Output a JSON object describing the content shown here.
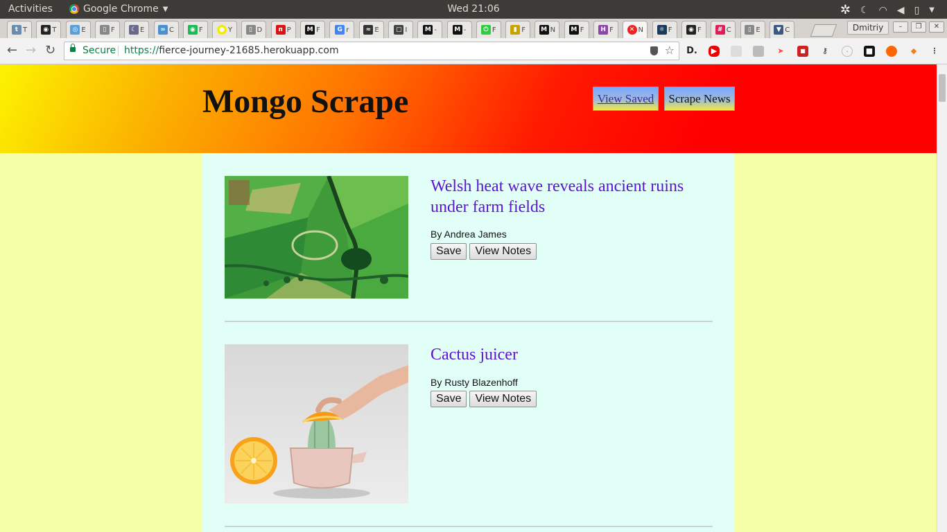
{
  "os": {
    "activities": "Activities",
    "app_name": "Google Chrome",
    "clock": "Wed 21:06"
  },
  "browser": {
    "profile": "Dmitriy",
    "secure_label": "Secure",
    "url_scheme": "https://",
    "url_host": "fierce-journey-21685.herokuapp.com"
  },
  "tabs": [
    {
      "icon": "T",
      "color": "#6a8caf",
      "label": "T"
    },
    {
      "icon": "github",
      "color": "#222",
      "label": "T"
    },
    {
      "icon": "eye",
      "color": "#5aa0d8",
      "label": "E"
    },
    {
      "icon": "doc",
      "color": "#888",
      "label": "F"
    },
    {
      "icon": "moon",
      "color": "#6a6a8a",
      "label": "E"
    },
    {
      "icon": "link",
      "color": "#4a8fd0",
      "label": "C"
    },
    {
      "icon": "spotify",
      "color": "#1db954",
      "label": "F"
    },
    {
      "icon": "dot",
      "color": "#f3ec00",
      "label": "Y"
    },
    {
      "icon": "doc",
      "color": "#888",
      "label": "D"
    },
    {
      "icon": "n",
      "color": "#d11",
      "label": "P"
    },
    {
      "icon": "M",
      "color": "#111",
      "label": "F"
    },
    {
      "icon": "G",
      "color": "#4285f4",
      "label": "r"
    },
    {
      "icon": "wave",
      "color": "#333",
      "label": "E"
    },
    {
      "icon": "box",
      "color": "#444",
      "label": "I"
    },
    {
      "icon": "M",
      "color": "#111",
      "label": "-"
    },
    {
      "icon": "M",
      "color": "#111",
      "label": "-"
    },
    {
      "icon": "power",
      "color": "#2ecc40",
      "label": "F"
    },
    {
      "icon": "bar",
      "color": "#c8a200",
      "label": "F"
    },
    {
      "icon": "M",
      "color": "#111",
      "label": "N"
    },
    {
      "icon": "M",
      "color": "#111",
      "label": "F"
    },
    {
      "icon": "H",
      "color": "#8e44ad",
      "label": "F"
    },
    {
      "icon": "close",
      "color": "#e22",
      "label": "N"
    },
    {
      "icon": "react",
      "color": "#1a3a5a",
      "label": "F"
    },
    {
      "icon": "github",
      "color": "#222",
      "label": "F"
    },
    {
      "icon": "slack",
      "color": "#e01e5a",
      "label": "C"
    },
    {
      "icon": "doc",
      "color": "#888",
      "label": "E"
    },
    {
      "icon": "shield",
      "color": "#3c5a80",
      "label": "C"
    }
  ],
  "page": {
    "title": "Mongo Scrape",
    "view_saved_label": "View Saved",
    "scrape_news_label": "Scrape News",
    "articles": [
      {
        "title": "Welsh heat wave reveals ancient ruins under farm fields",
        "byline": "By Andrea James",
        "save_label": "Save",
        "notes_label": "View Notes",
        "image": "aerial photo of green farm fields"
      },
      {
        "title": "Cactus juicer",
        "byline": "By Rusty Blazenhoff",
        "save_label": "Save",
        "notes_label": "View Notes",
        "image": "hand pressing orange on cactus-shaped juicer"
      }
    ]
  }
}
